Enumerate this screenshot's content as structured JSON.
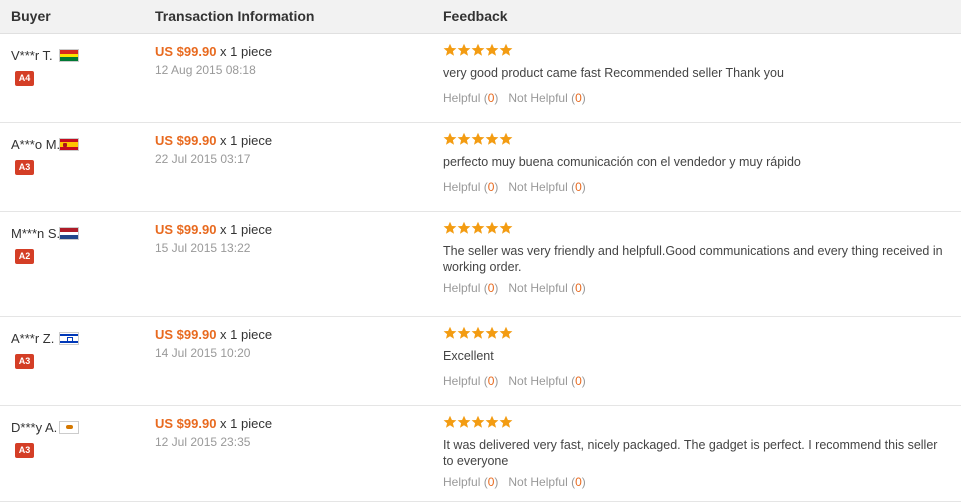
{
  "header": {
    "buyer": "Buyer",
    "transaction": "Transaction Information",
    "feedback": "Feedback"
  },
  "colors": {
    "price": "#e86a1f",
    "star": "#f39c12",
    "badge": "#d43e26"
  },
  "rows": [
    {
      "buyer": "V***r T.",
      "flag": "bolivia-flag-icon",
      "badge": "A4",
      "price": "US $99.90",
      "qty": " x 1 piece",
      "date": "12 Aug 2015 08:18",
      "rating": 5,
      "comment": "very good product came fast Recommended seller Thank you",
      "helpful_label": "Helpful (",
      "helpful_count": "0",
      "not_helpful_label": "Not Helpful (",
      "not_helpful_count": "0",
      "close": ")"
    },
    {
      "buyer": "A***o M.",
      "flag": "spain-flag-icon",
      "badge": "A3",
      "price": "US $99.90",
      "qty": " x 1 piece",
      "date": "22 Jul 2015 03:17",
      "rating": 5,
      "comment": "perfecto muy buena comunicación con el vendedor y muy rápido",
      "helpful_label": "Helpful (",
      "helpful_count": "0",
      "not_helpful_label": "Not Helpful (",
      "not_helpful_count": "0",
      "close": ")"
    },
    {
      "buyer": "M***n S.",
      "flag": "netherlands-flag-icon",
      "badge": "A2",
      "price": "US $99.90",
      "qty": " x 1 piece",
      "date": "15 Jul 2015 13:22",
      "rating": 5,
      "comment": "The seller was very friendly and helpfull.Good communications and every thing received in working order.",
      "helpful_label": "Helpful (",
      "helpful_count": "0",
      "not_helpful_label": "Not Helpful (",
      "not_helpful_count": "0",
      "close": ")"
    },
    {
      "buyer": "A***r Z.",
      "flag": "israel-flag-icon",
      "badge": "A3",
      "price": "US $99.90",
      "qty": " x 1 piece",
      "date": "14 Jul 2015 10:20",
      "rating": 5,
      "comment": "Excellent",
      "helpful_label": "Helpful (",
      "helpful_count": "0",
      "not_helpful_label": "Not Helpful (",
      "not_helpful_count": "0",
      "close": ")"
    },
    {
      "buyer": "D***y A.",
      "flag": "cyprus-flag-icon",
      "badge": "A3",
      "price": "US $99.90",
      "qty": " x 1 piece",
      "date": "12 Jul 2015 23:35",
      "rating": 5,
      "comment": "It was delivered very fast, nicely packaged. The gadget is perfect. I recommend this seller to everyone",
      "helpful_label": "Helpful (",
      "helpful_count": "0",
      "not_helpful_label": "Not Helpful (",
      "not_helpful_count": "0",
      "close": ")"
    }
  ]
}
